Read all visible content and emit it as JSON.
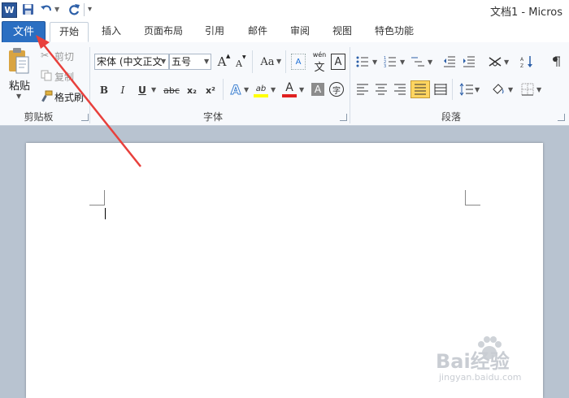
{
  "window": {
    "title": "文档1 - Micros",
    "app_icon_letter": "W"
  },
  "tabs": [
    "文件",
    "开始",
    "插入",
    "页面布局",
    "引用",
    "邮件",
    "审阅",
    "视图",
    "特色功能"
  ],
  "clipboard": {
    "paste": "粘贴",
    "cut": "剪切",
    "copy": "复制",
    "format_painter": "格式刷",
    "group_label": "剪贴板"
  },
  "font": {
    "name": "宋体 (中文正文",
    "size": "五号",
    "group_label": "字体",
    "bold": "B",
    "italic": "I",
    "underline": "U",
    "strike": "abc",
    "subscript": "x₂",
    "superscript": "x²",
    "grow": "A",
    "shrink": "A",
    "change_case": "Aa",
    "clear_format": "A",
    "phonetic": "wén",
    "phonetic_char": "文",
    "border_char": "A",
    "highlight": "ab",
    "font_color": "A",
    "shading": "A",
    "enclose": "字"
  },
  "paragraph": {
    "group_label": "段落"
  },
  "colors": {
    "file_tab": "#2b6fc2",
    "highlight": "#ffff00",
    "font_color": "#e02020",
    "arrow": "#e8403c",
    "active_align": "#ffd560"
  },
  "watermark": {
    "brand": "Bai经验",
    "url": "jingyan.baidu.com"
  }
}
